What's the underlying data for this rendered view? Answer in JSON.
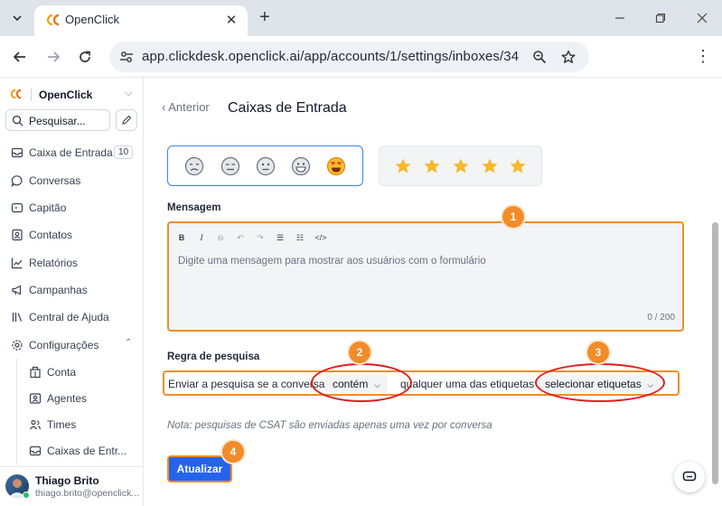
{
  "browser": {
    "tab_title": "OpenClick",
    "url": "app.clickdesk.openclick.ai/app/accounts/1/settings/inboxes/34"
  },
  "sidebar": {
    "brand": "OpenClick",
    "search_label": "Pesquisar...",
    "items": [
      {
        "label": "Caixa de Entrada",
        "badge": "10",
        "icon": "inbox-icon"
      },
      {
        "label": "Conversas",
        "icon": "chat-bubble-icon"
      },
      {
        "label": "Capitão",
        "icon": "captain-icon"
      },
      {
        "label": "Contatos",
        "icon": "contacts-icon"
      },
      {
        "label": "Relatórios",
        "icon": "chart-icon"
      },
      {
        "label": "Campanhas",
        "icon": "megaphone-icon"
      },
      {
        "label": "Central de Ajuda",
        "icon": "library-icon"
      },
      {
        "label": "Configurações",
        "icon": "gear-icon"
      }
    ],
    "sub_items": [
      {
        "label": "Conta",
        "icon": "building-icon"
      },
      {
        "label": "Agentes",
        "icon": "id-card-icon"
      },
      {
        "label": "Times",
        "icon": "team-icon"
      },
      {
        "label": "Caixas de Entr...",
        "icon": "inbox-icon"
      }
    ],
    "user": {
      "name": "Thiago Brito",
      "email": "thiago.brito@openclick..."
    }
  },
  "main": {
    "back_label": "Anterior",
    "title": "Caixas de Entrada",
    "rating_emojis": [
      "disappointed-face",
      "expressionless-face",
      "neutral-face",
      "grinning-face",
      "heart-eyes-face"
    ],
    "star_count": 5,
    "message": {
      "label": "Mensagem",
      "placeholder": "Digite uma mensagem para mostrar aos usuários com o formulário",
      "counter": "0 / 200"
    },
    "rule": {
      "label": "Regra de pesquisa",
      "text_before": "Enviar a pesquisa se a conversa",
      "operator": "contém",
      "text_middle": "qualquer uma das etiquetas",
      "labels_select": "selecionar etiquetas"
    },
    "note": "Nota: pesquisas de CSAT são enviadas apenas uma vez por conversa",
    "update_button": "Atualizar",
    "markers": [
      "1",
      "2",
      "3",
      "4"
    ]
  },
  "colors": {
    "accent": "#2563eb",
    "highlight": "#f28c28",
    "circle": "#e11d1d",
    "star": "#f5b82e"
  }
}
